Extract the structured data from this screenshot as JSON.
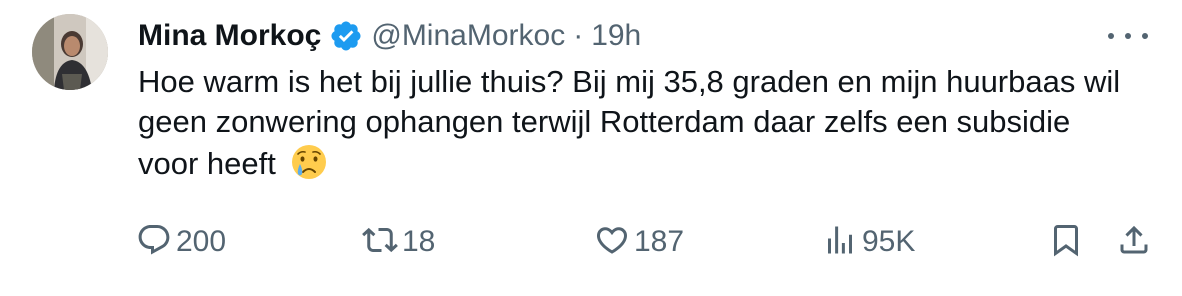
{
  "author": {
    "name": "Mina Morkoç",
    "handle": "@MinaMorkoc",
    "separator": "·",
    "time": "19h"
  },
  "tweet": {
    "text": "Hoe warm is het bij jullie thuis? Bij mij 35,8 graden en mijn huurbaas wil geen zonwering ophangen terwijl Rotterdam daar zelfs een subsidie voor heeft",
    "emoji": "crying-face"
  },
  "actions": {
    "replies": "200",
    "reposts": "18",
    "likes": "187",
    "views": "95K"
  },
  "colors": {
    "text": "#0f1419",
    "secondary": "#536471",
    "verified": "#1d9bf0",
    "emoji": "#ffcc4d"
  },
  "icons": [
    "reply-icon",
    "repost-icon",
    "like-icon",
    "views-icon",
    "bookmark-icon",
    "share-icon",
    "more-icon",
    "verified-badge-icon"
  ]
}
